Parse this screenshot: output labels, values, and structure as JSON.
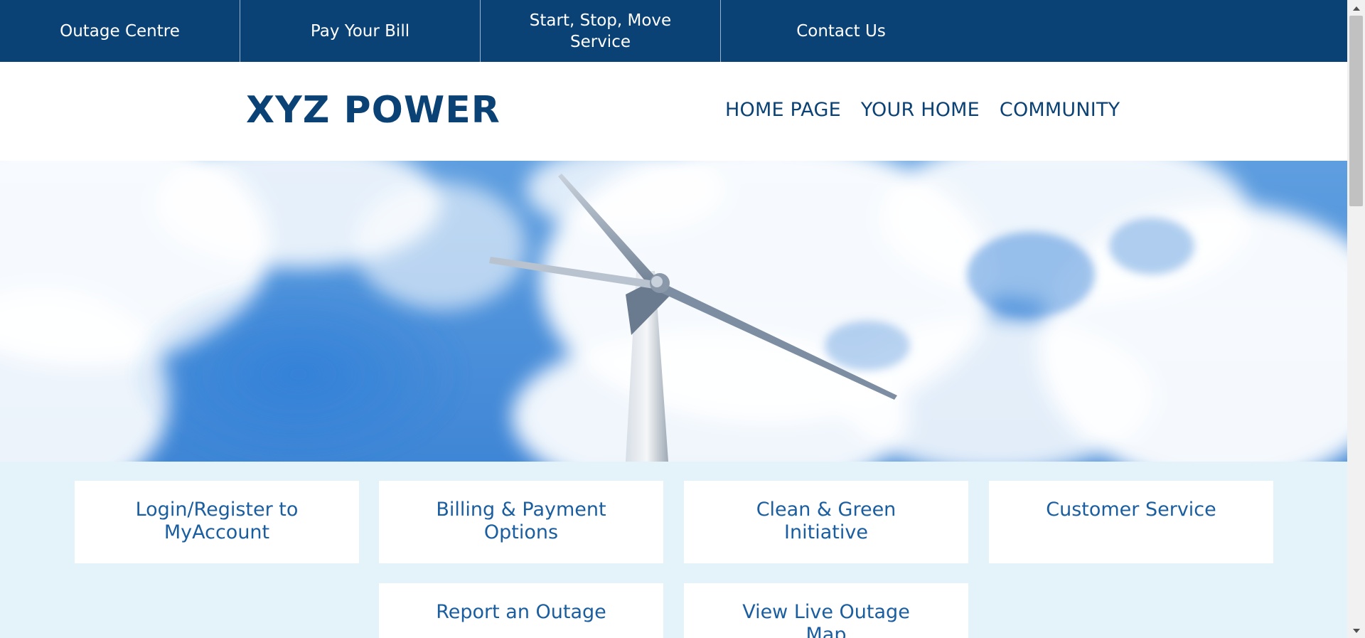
{
  "topbar": {
    "tabs": [
      {
        "label": "Outage Centre"
      },
      {
        "label": "Pay Your Bill"
      },
      {
        "label": "Start, Stop, Move Service"
      },
      {
        "label": "Contact Us"
      }
    ]
  },
  "header": {
    "logo": "XYZ POWER",
    "nav": [
      {
        "label": "HOME PAGE"
      },
      {
        "label": "YOUR HOME"
      },
      {
        "label": "COMMUNITY"
      }
    ]
  },
  "tiles": [
    {
      "label": "Login/Register to MyAccount"
    },
    {
      "label": "Billing & Payment Options"
    },
    {
      "label": "Clean & Green Initiative"
    },
    {
      "label": "Customer Service"
    },
    {
      "label": "Report an Outage"
    },
    {
      "label": "View Live Outage Map"
    }
  ],
  "colors": {
    "brand_navy": "#0b4275",
    "tile_text": "#1a5ea0",
    "tile_section_bg": "#e4f3f9"
  }
}
